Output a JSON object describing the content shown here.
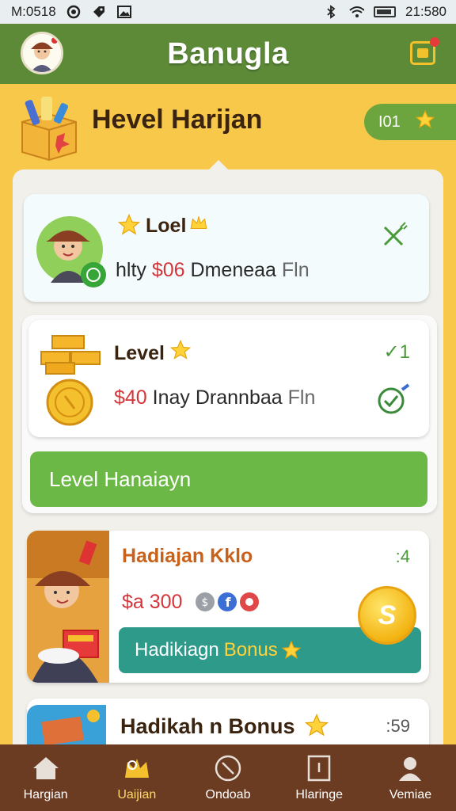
{
  "status_bar": {
    "time_left": "M:0518",
    "time_right": "21:580"
  },
  "header": {
    "title": "Banugla"
  },
  "page": {
    "title": "Hevel Harijan",
    "pill_label": "I01"
  },
  "cards": [
    {
      "title": "Loel",
      "line_a": "hlty",
      "money": "$06",
      "line_b": "Dmeneaa",
      "badge": "Fln",
      "side": ""
    },
    {
      "title": "Level",
      "line_a": "",
      "money": "$40",
      "line_b": "Inay Drannbaa",
      "badge": "Fln",
      "side": "✓1"
    },
    {
      "title": "Hadiajan Kklo",
      "line_a": "",
      "money": "$a 300",
      "line_b": "",
      "badge": "",
      "side": ":4"
    },
    {
      "title": "Hadikah n Bonus",
      "line_a": "",
      "money": "",
      "line_b": "",
      "badge": "",
      "side": ":59"
    }
  ],
  "buttons": {
    "level_button": "Level Hanaiayn",
    "bonus_button_a": "Hadikiagn",
    "bonus_button_b": "Bonus"
  },
  "coin_label": "S",
  "nav": [
    {
      "label": "Hargian",
      "icon": "home-icon"
    },
    {
      "label": "Uaijian",
      "icon": "crown-icon"
    },
    {
      "label": "Ondoab",
      "icon": "compass-icon"
    },
    {
      "label": "Hlaringe",
      "icon": "document-icon"
    },
    {
      "label": "Vemiae",
      "icon": "profile-icon"
    }
  ],
  "colors": {
    "header_green": "#5c8a37",
    "background_yellow": "#f7c84a",
    "action_green": "#6cb846",
    "teal": "#2d9a8a",
    "money_red": "#d3363a",
    "nav_brown": "#6b3c22"
  }
}
